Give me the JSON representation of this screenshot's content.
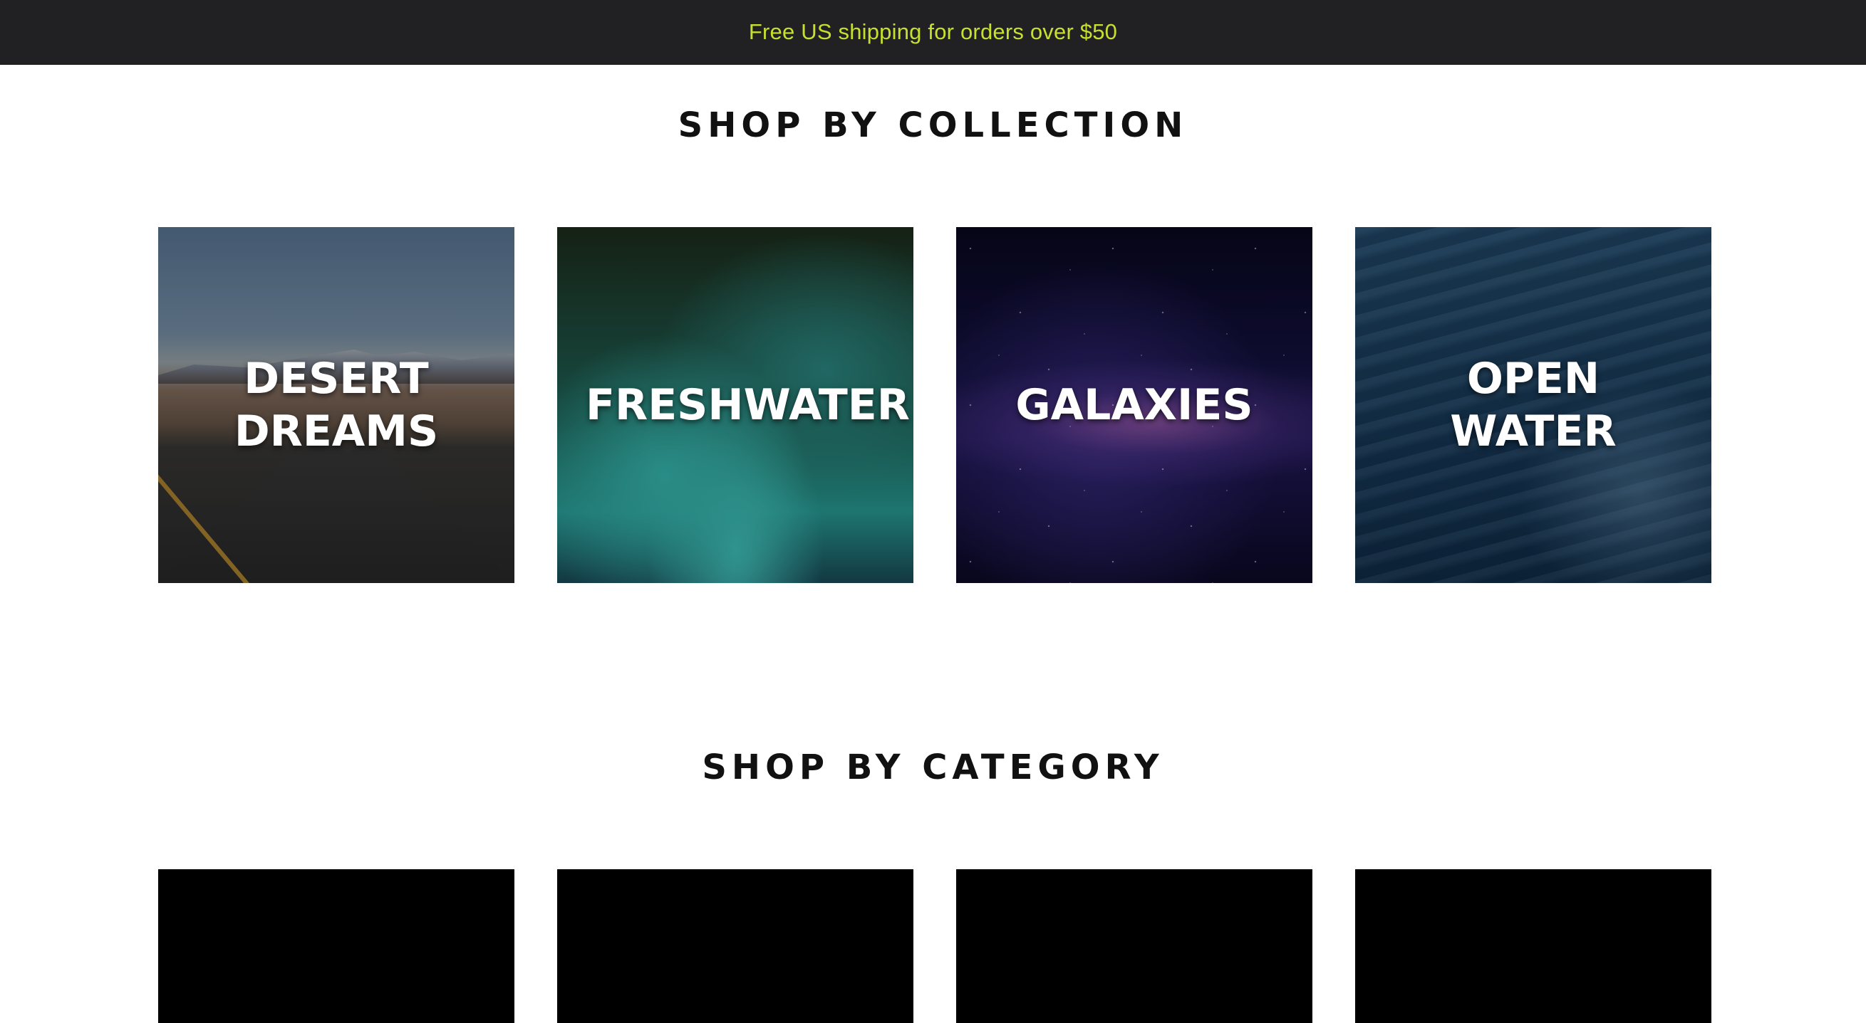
{
  "announcement": {
    "text": "Free US shipping for orders over $50"
  },
  "collections": {
    "title": "SHOP BY COLLECTION",
    "items": [
      {
        "label": "DESERT DREAMS"
      },
      {
        "label": "FRESHWATER"
      },
      {
        "label": "GALAXIES"
      },
      {
        "label": "OPEN WATER"
      }
    ]
  },
  "categories": {
    "title": "SHOP BY CATEGORY"
  },
  "colors": {
    "announcement_bg": "#212123",
    "announcement_text": "#c7e02f",
    "heading": "#111111"
  }
}
